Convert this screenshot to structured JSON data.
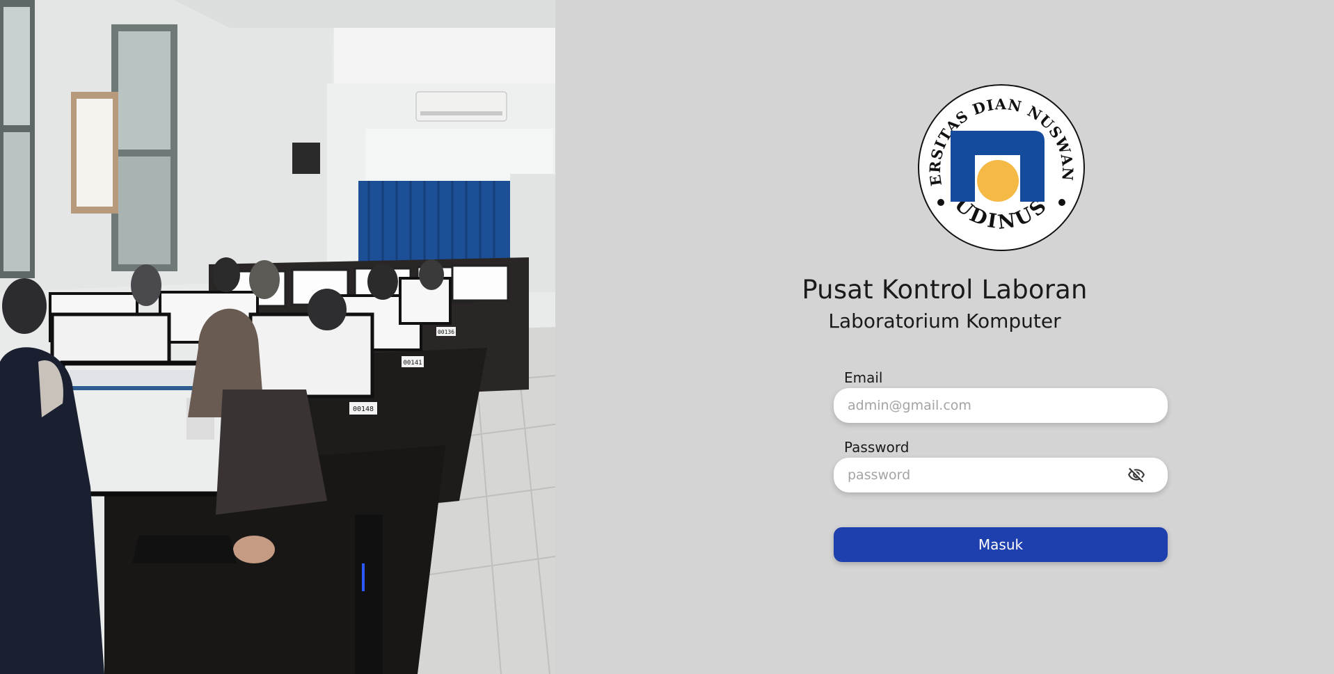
{
  "photo": {
    "alt": "Computer laboratory with students taking an exam",
    "desk_labels": [
      "00141",
      "00148",
      "00136"
    ]
  },
  "logo": {
    "ring_text_top": "UNIVERSITAS DIAN NUSWANTORO",
    "ring_text_bottom": "UDINUS",
    "colors": {
      "blue": "#154b9c",
      "yellow": "#f5b945",
      "black": "#111111"
    }
  },
  "header": {
    "title": "Pusat Kontrol Laboran",
    "subtitle": "Laboratorium Komputer"
  },
  "form": {
    "email_label": "Email",
    "email_placeholder": "admin@gmail.com",
    "password_label": "Password",
    "password_placeholder": "password",
    "password_toggle_icon": "eye-off-icon",
    "submit_label": "Masuk"
  },
  "colors": {
    "background": "#d4d4d4",
    "button": "#1e3fae"
  }
}
